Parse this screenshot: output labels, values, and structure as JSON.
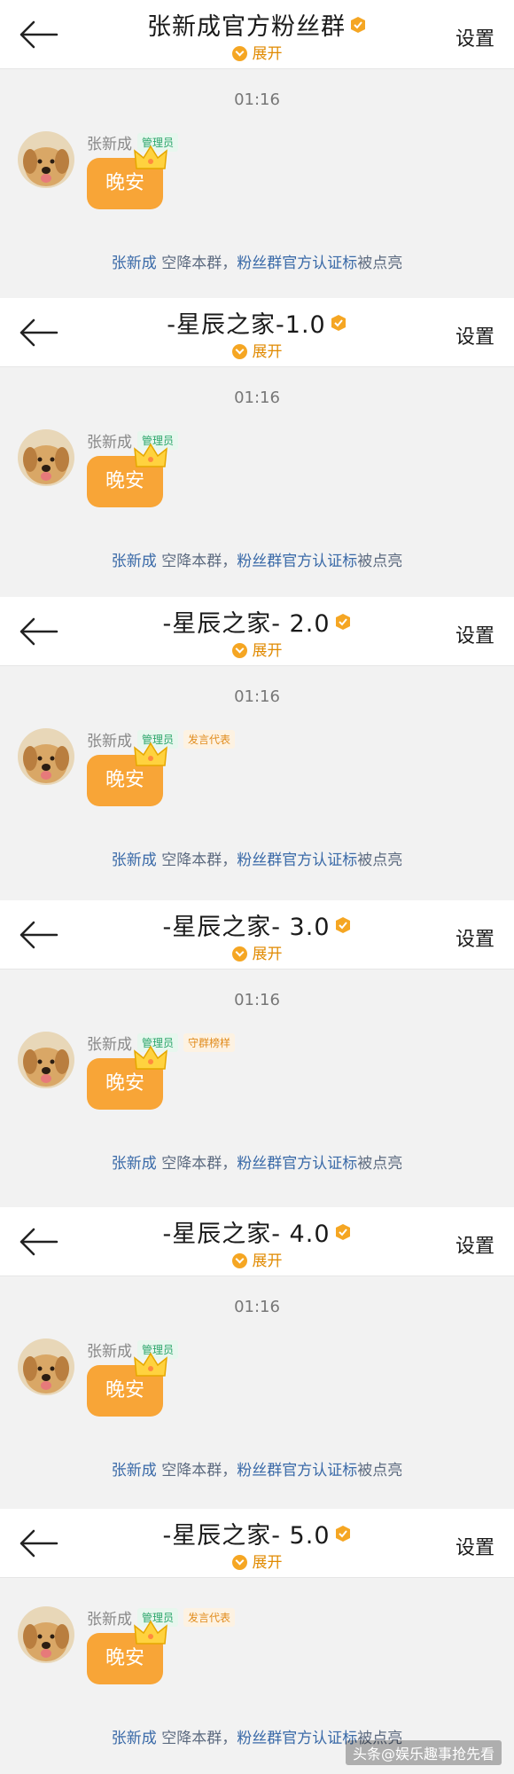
{
  "colors": {
    "accent_orange": "#f8a537",
    "link_blue": "#3a6aa8",
    "admin_green": "#2aa56a",
    "role_orange": "#e18c1d"
  },
  "screens": [
    {
      "title": "张新成官方粉丝群",
      "expand": "展开",
      "settings": "设置",
      "time": "01:16",
      "sender": "张新成",
      "badges": [
        "管理员"
      ],
      "message": "晚安",
      "notice": {
        "name": "张新成",
        "mid": "空降本群，",
        "link": "粉丝群官方认证标",
        "tail": "被点亮"
      }
    },
    {
      "title": "-星辰之家-1.0",
      "expand": "展开",
      "settings": "设置",
      "time": "01:16",
      "sender": "张新成",
      "badges": [
        "管理员"
      ],
      "message": "晚安",
      "notice": {
        "name": "张新成",
        "mid": "空降本群，",
        "link": "粉丝群官方认证标",
        "tail": "被点亮"
      }
    },
    {
      "title": "-星辰之家- 2.0",
      "expand": "展开",
      "settings": "设置",
      "time": "01:16",
      "sender": "张新成",
      "badges": [
        "管理员",
        "发言代表"
      ],
      "message": "晚安",
      "notice": {
        "name": "张新成",
        "mid": "空降本群，",
        "link": "粉丝群官方认证标",
        "tail": "被点亮"
      }
    },
    {
      "title": "-星辰之家- 3.0",
      "expand": "展开",
      "settings": "设置",
      "time": "01:16",
      "sender": "张新成",
      "badges": [
        "管理员",
        "守群榜样"
      ],
      "message": "晚安",
      "notice": {
        "name": "张新成",
        "mid": "空降本群，",
        "link": "粉丝群官方认证标",
        "tail": "被点亮"
      }
    },
    {
      "title": "-星辰之家- 4.0",
      "expand": "展开",
      "settings": "设置",
      "time": "01:16",
      "sender": "张新成",
      "badges": [
        "管理员"
      ],
      "message": "晚安",
      "notice": {
        "name": "张新成",
        "mid": "空降本群，",
        "link": "粉丝群官方认证标",
        "tail": "被点亮"
      }
    },
    {
      "title": "-星辰之家- 5.0",
      "expand": "展开",
      "settings": "设置",
      "time": "",
      "sender": "张新成",
      "badges": [
        "管理员",
        "发言代表"
      ],
      "message": "晚安",
      "notice": {
        "name": "张新成",
        "mid": "空降本群，",
        "link": "粉丝群官方认证标",
        "tail": "被点亮"
      }
    }
  ],
  "watermark": "头条@娱乐趣事抢先看"
}
